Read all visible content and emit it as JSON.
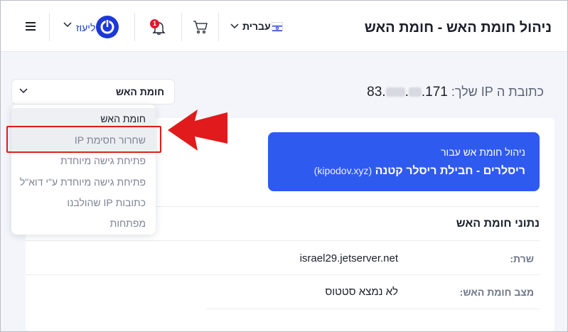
{
  "header": {
    "title": "ניהול חומת האש - חומת האש",
    "user_name": "ליעוז",
    "notification_count": "1",
    "language_label": "עברית",
    "icons": {
      "menu": "hamburger-icon",
      "power": "power-icon",
      "bell": "bell-icon",
      "cart": "cart-icon",
      "flag": "israel-flag-icon"
    }
  },
  "ip_info": {
    "label": "כתובת ה IP שלך:",
    "ip_start": "83.",
    "ip_mid": ".",
    "ip_end": ".171"
  },
  "firewall_dropdown": {
    "selected": "חומת האש",
    "options": [
      "חומת האש",
      "שחרור חסימת IP",
      "פתיחת גישה מיוחדת",
      "פתיחת גישה מיוחדת ע\"י דוא\"ל",
      "כתובות IP שהולבנו",
      "מפתחות"
    ]
  },
  "banner": {
    "line1": "ניהול חומת אש עבור",
    "line2": "ריסלרים - חבילת ריסלר קטנה",
    "domain": "(kipodov.xyz)"
  },
  "details": {
    "title": "נתוני חומת האש",
    "rows": [
      {
        "label": "שרת:",
        "value": "israel29.jetserver.net"
      },
      {
        "label": "מצב חומת האש:",
        "value": "לא נמצא סטטוס"
      }
    ]
  },
  "colors": {
    "accent": "#2f5af0",
    "brand_blue": "#1c38d6",
    "annotation_red": "#e11b1b",
    "badge_red": "#e0172d"
  }
}
